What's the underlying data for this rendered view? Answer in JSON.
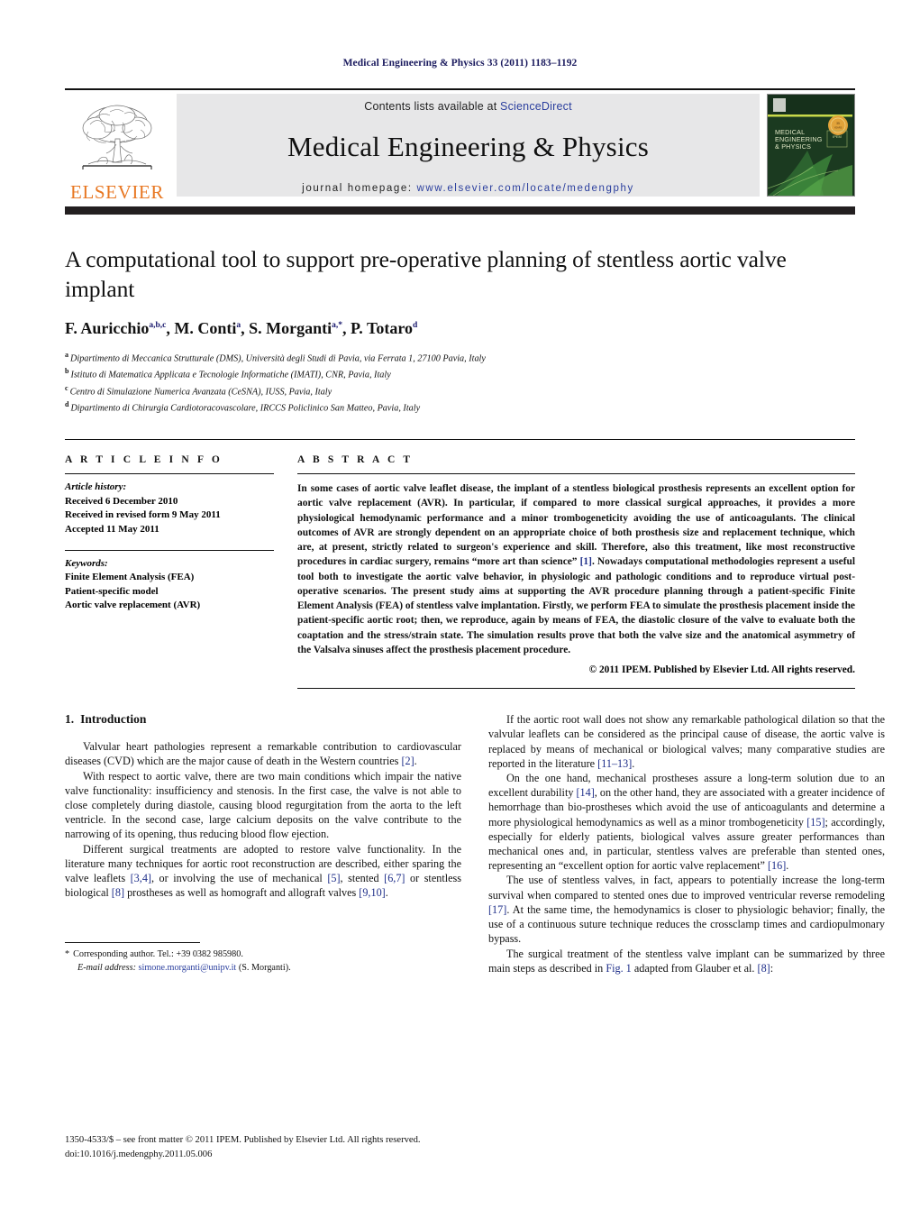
{
  "running_head": "Medical Engineering & Physics 33 (2011) 1183–1192",
  "masthead": {
    "publisher_name": "ELSEVIER",
    "contents_prefix": "Contents lists available at ",
    "contents_link": "ScienceDirect",
    "journal_title": "Medical Engineering & Physics",
    "homepage_prefix": "journal homepage: ",
    "homepage_url": "www.elsevier.com/locate/medengphy",
    "cover_title_line1": "MEDICAL",
    "cover_title_line2": "ENGINEERING",
    "cover_title_line3": "& PHYSICS",
    "colors": {
      "elsevier_orange": "#E87722",
      "link_blue": "#2b3f9e",
      "band_dark": "#231f20",
      "masthead_grey": "#e7e7e8",
      "cover_green": "#17331c"
    }
  },
  "article": {
    "title": "A computational tool to support pre-operative planning of stentless aortic valve implant",
    "authors": [
      {
        "name": "F. Auricchio",
        "marks": "a,b,c"
      },
      {
        "name": "M. Conti",
        "marks": "a"
      },
      {
        "name": "S. Morganti",
        "marks": "a,*"
      },
      {
        "name": "P. Totaro",
        "marks": "d"
      }
    ],
    "affiliations": [
      {
        "mark": "a",
        "text": "Dipartimento di Meccanica Strutturale (DMS), Università degli Studi di Pavia, via Ferrata 1, 27100 Pavia, Italy"
      },
      {
        "mark": "b",
        "text": "Istituto di Matematica Applicata e Tecnologie Informatiche (IMATI), CNR, Pavia, Italy"
      },
      {
        "mark": "c",
        "text": "Centro di Simulazione Numerica Avanzata (CeSNA), IUSS, Pavia, Italy"
      },
      {
        "mark": "d",
        "text": "Dipartimento di Chirurgia Cardiotoracovascolare, IRCCS Policlinico San Matteo, Pavia, Italy"
      }
    ]
  },
  "article_info": {
    "heading": "A R T I C L E   I N F O",
    "history_label": "Article history:",
    "history": [
      "Received 6 December 2010",
      "Received in revised form 9 May 2011",
      "Accepted 11 May 2011"
    ],
    "keywords_label": "Keywords:",
    "keywords": [
      "Finite Element Analysis (FEA)",
      "Patient-specific model",
      "Aortic valve replacement (AVR)"
    ]
  },
  "abstract": {
    "heading": "A B S T R A C T",
    "paragraph_1": "In some cases of aortic valve leaflet disease, the implant of a stentless biological prosthesis represents an excellent option for aortic valve replacement (AVR). In particular, if compared to more classical surgical approaches, it provides a more physiological hemodynamic performance and a minor trombogeneticity avoiding the use of anticoagulants. The clinical outcomes of AVR are strongly dependent on an appropriate choice of both prosthesis size and replacement technique, which are, at present, strictly related to surgeon's experience and skill. Therefore, also this treatment, like most reconstructive procedures in cardiac surgery, remains “more art than science” ",
    "ref_1": "[1]",
    "paragraph_2": ". Nowadays computational methodologies represent a useful tool both to investigate the aortic valve behavior, in physiologic and pathologic conditions and to reproduce virtual post-operative scenarios. The present study aims at supporting the AVR procedure planning through a patient-specific Finite Element Analysis (FEA) of stentless valve implantation. Firstly, we perform FEA to simulate the prosthesis placement inside the patient-specific aortic root; then, we reproduce, again by means of FEA, the diastolic closure of the valve to evaluate both the coaptation and the stress/strain state. The simulation results prove that both the valve size and the anatomical asymmetry of the Valsalva sinuses affect the prosthesis placement procedure.",
    "copyright": "© 2011 IPEM. Published by Elsevier Ltd. All rights reserved."
  },
  "introduction": {
    "number": "1.",
    "heading": "Introduction",
    "left_paragraphs": [
      {
        "parts": [
          {
            "t": "Valvular heart pathologies represent a remarkable contribution to cardiovascular diseases (CVD) which are the major cause of death in the Western countries "
          },
          {
            "r": "[2]"
          },
          {
            "t": "."
          }
        ]
      },
      {
        "parts": [
          {
            "t": "With respect to aortic valve, there are two main conditions which impair the native valve functionality: insufficiency and stenosis. In the first case, the valve is not able to close completely during diastole, causing blood regurgitation from the aorta to the left ventricle. In the second case, large calcium deposits on the valve contribute to the narrowing of its opening, thus reducing blood flow ejection."
          }
        ]
      },
      {
        "parts": [
          {
            "t": "Different surgical treatments are adopted to restore valve functionality. In the literature many techniques for aortic root reconstruction are described, either sparing the valve leaflets "
          },
          {
            "r": "[3,4]"
          },
          {
            "t": ", or involving the use of mechanical "
          },
          {
            "r": "[5]"
          },
          {
            "t": ", stented "
          },
          {
            "r": "[6,7]"
          },
          {
            "t": " or stentless biological "
          },
          {
            "r": "[8]"
          },
          {
            "t": " prostheses as well as homograft and allograft valves "
          },
          {
            "r": "[9,10]"
          },
          {
            "t": "."
          }
        ]
      }
    ],
    "right_paragraphs": [
      {
        "parts": [
          {
            "t": "If the aortic root wall does not show any remarkable pathological dilation so that the valvular leaflets can be considered as the principal cause of disease, the aortic valve is replaced by means of mechanical or biological valves; many comparative studies are reported in the literature "
          },
          {
            "r": "[11–13]"
          },
          {
            "t": "."
          }
        ]
      },
      {
        "parts": [
          {
            "t": "On the one hand, mechanical prostheses assure a long-term solution due to an excellent durability "
          },
          {
            "r": "[14]"
          },
          {
            "t": ", on the other hand, they are associated with a greater incidence of hemorrhage than bio-prostheses which avoid the use of anticoagulants and determine a more physiological hemodynamics as well as a minor trombogeneticity "
          },
          {
            "r": "[15]"
          },
          {
            "t": "; accordingly, especially for elderly patients, biological valves assure greater performances than mechanical ones and, in particular, stentless valves are preferable than stented ones, representing an “excellent option for aortic valve replacement” "
          },
          {
            "r": "[16]"
          },
          {
            "t": "."
          }
        ]
      },
      {
        "parts": [
          {
            "t": "The use of stentless valves, in fact, appears to potentially increase the long-term survival when compared to stented ones due to improved ventricular reverse remodeling "
          },
          {
            "r": "[17]"
          },
          {
            "t": ". At the same time, the hemodynamics is closer to physiologic behavior; finally, the use of a continuous suture technique reduces the crossclamp times and cardiopulmonary bypass."
          }
        ]
      },
      {
        "parts": [
          {
            "t": "The surgical treatment of the stentless valve implant can be summarized by three main steps as described in "
          },
          {
            "r": "Fig. 1"
          },
          {
            "t": " adapted from Glauber et al. "
          },
          {
            "r": "[8]"
          },
          {
            "t": ":"
          }
        ]
      }
    ]
  },
  "footnote": {
    "star": "*",
    "corresponding": "Corresponding author. Tel.: +39 0382 985980.",
    "email_label": "E-mail address:",
    "email": "simone.morganti@unipv.it",
    "email_suffix": "(S. Morganti)."
  },
  "page_footer": {
    "issn_line": "1350-4533/$ – see front matter © 2011 IPEM. Published by Elsevier Ltd. All rights reserved.",
    "doi_line": "doi:10.1016/j.medengphy.2011.05.006"
  }
}
